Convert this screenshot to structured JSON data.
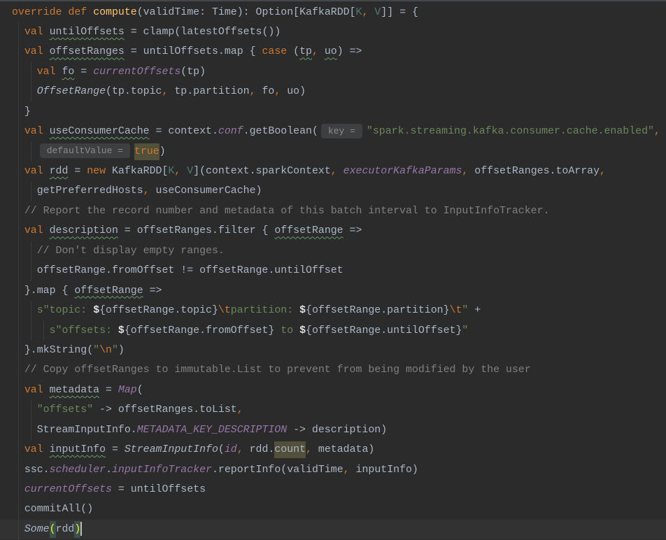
{
  "editor": {
    "lines": [
      {
        "tokens": [
          {
            "keyword": "override"
          },
          {
            "plain": " "
          },
          {
            "keyword": "def"
          },
          {
            "plain": " "
          },
          {
            "method": "compute"
          },
          {
            "plain": "(validTime: Time): Option[KafkaRDD["
          },
          {
            "type_param": "K"
          },
          {
            "comma": ","
          },
          {
            "plain": " "
          },
          {
            "type_param": "V"
          },
          {
            "plain": "]] = {"
          }
        ]
      },
      {
        "tokens": [
          {
            "plain": "  "
          },
          {
            "keyword": "val"
          },
          {
            "plain": " "
          },
          {
            "plain": "untilOffsets",
            "squiggly": true
          },
          {
            "plain": " = clamp(latestOffsets())"
          }
        ]
      },
      {
        "tokens": [
          {
            "plain": "  "
          },
          {
            "keyword": "val"
          },
          {
            "plain": " "
          },
          {
            "plain": "offsetRanges",
            "squiggly": true
          },
          {
            "plain": " = untilOffsets.map { "
          },
          {
            "keyword": "case"
          },
          {
            "plain": " ("
          },
          {
            "plain": "tp",
            "squiggly": true
          },
          {
            "comma": ","
          },
          {
            "plain": " "
          },
          {
            "plain": "uo",
            "squiggly": true
          },
          {
            "plain": ") =>"
          }
        ]
      },
      {
        "tokens": [
          {
            "plain": "    "
          },
          {
            "keyword": "val"
          },
          {
            "plain": " "
          },
          {
            "plain": "fo",
            "squiggly": true
          },
          {
            "plain": " = "
          },
          {
            "field": "currentOffsets"
          },
          {
            "plain": "(tp)"
          }
        ]
      },
      {
        "tokens": [
          {
            "plain": "    "
          },
          {
            "call": "OffsetRange"
          },
          {
            "plain": "(tp.topic"
          },
          {
            "comma": ","
          },
          {
            "plain": " tp.partition"
          },
          {
            "comma": ","
          },
          {
            "plain": " fo"
          },
          {
            "comma": ","
          },
          {
            "plain": " uo)"
          }
        ]
      },
      {
        "tokens": [
          {
            "plain": "  }"
          }
        ]
      },
      {
        "tokens": [
          {
            "plain": "  "
          },
          {
            "keyword": "val"
          },
          {
            "plain": " "
          },
          {
            "plain": "useConsumerCache",
            "squiggly": true
          },
          {
            "plain": " = context."
          },
          {
            "field": "conf"
          },
          {
            "plain": ".getBoolean("
          },
          {
            "hint": "key ="
          },
          {
            "string": "\"spark.streaming.kafka.consumer.cache.enabled\""
          },
          {
            "comma": ","
          }
        ]
      },
      {
        "tokens": [
          {
            "plain": "    "
          },
          {
            "hint": "defaultValue ="
          },
          {
            "keyword": "true",
            "usage": true
          },
          {
            "plain": ")"
          }
        ]
      },
      {
        "tokens": [
          {
            "plain": "  "
          },
          {
            "keyword": "val"
          },
          {
            "plain": " "
          },
          {
            "plain": "rdd",
            "squiggly": true
          },
          {
            "plain": " = "
          },
          {
            "keyword": "new"
          },
          {
            "plain": " KafkaRDD["
          },
          {
            "type_param": "K"
          },
          {
            "comma": ","
          },
          {
            "plain": " "
          },
          {
            "type_param": "V"
          },
          {
            "plain": "](context.sparkContext"
          },
          {
            "comma": ","
          },
          {
            "plain": " "
          },
          {
            "field": "executorKafkaParams"
          },
          {
            "comma": ","
          },
          {
            "plain": " offsetRanges.toArray"
          },
          {
            "comma": ","
          }
        ]
      },
      {
        "tokens": [
          {
            "plain": "    getPreferredHosts"
          },
          {
            "comma": ","
          },
          {
            "plain": " useConsumerCache)"
          }
        ]
      },
      {
        "tokens": [
          {
            "plain": "  "
          },
          {
            "comment": "// Report the record number and metadata of this batch interval to InputInfoTracker."
          }
        ]
      },
      {
        "tokens": [
          {
            "plain": "  "
          },
          {
            "keyword": "val"
          },
          {
            "plain": " "
          },
          {
            "plain": "description",
            "squiggly": true
          },
          {
            "plain": " = offsetRanges.filter { "
          },
          {
            "plain": "offsetRange",
            "squiggly": true
          },
          {
            "plain": " =>"
          }
        ]
      },
      {
        "tokens": [
          {
            "plain": "    "
          },
          {
            "comment": "// Don't display empty ranges."
          }
        ]
      },
      {
        "tokens": [
          {
            "plain": "    offsetRange.fromOffset != offsetRange.untilOffset"
          }
        ]
      },
      {
        "tokens": [
          {
            "plain": "  }.map { "
          },
          {
            "plain": "offsetRange",
            "squiggly": true
          },
          {
            "plain": " =>"
          }
        ]
      },
      {
        "tokens": [
          {
            "plain": "    "
          },
          {
            "string": "s\"topic: "
          },
          {
            "interp": "$"
          },
          {
            "plain": "{offsetRange.topic}"
          },
          {
            "escape": "\\t"
          },
          {
            "string": "partition: "
          },
          {
            "interp": "$"
          },
          {
            "plain": "{offsetRange.partition}"
          },
          {
            "escape": "\\t"
          },
          {
            "string": "\""
          },
          {
            "plain": " +"
          }
        ]
      },
      {
        "tokens": [
          {
            "plain": "      "
          },
          {
            "string": "s\"offsets: "
          },
          {
            "interp": "$"
          },
          {
            "plain": "{offsetRange.fromOffset}"
          },
          {
            "string": " to "
          },
          {
            "interp": "$"
          },
          {
            "plain": "{offsetRange.untilOffset}"
          },
          {
            "string": "\""
          }
        ]
      },
      {
        "tokens": [
          {
            "plain": "  }.mkString("
          },
          {
            "string": "\""
          },
          {
            "escape": "\\n"
          },
          {
            "string": "\""
          },
          {
            "plain": ")"
          }
        ]
      },
      {
        "tokens": [
          {
            "plain": "  "
          },
          {
            "comment": "// Copy offsetRanges to immutable.List to prevent from being modified by the user"
          }
        ]
      },
      {
        "tokens": [
          {
            "plain": "  "
          },
          {
            "keyword": "val"
          },
          {
            "plain": " "
          },
          {
            "plain": "metadata",
            "squiggly": true
          },
          {
            "plain": " = "
          },
          {
            "field": "Map"
          },
          {
            "plain": "("
          }
        ]
      },
      {
        "tokens": [
          {
            "plain": "    "
          },
          {
            "string": "\"offsets\""
          },
          {
            "plain": " -> offsetRanges.toList"
          },
          {
            "comma": ","
          }
        ]
      },
      {
        "tokens": [
          {
            "plain": "    StreamInputInfo."
          },
          {
            "field": "METADATA_KEY_DESCRIPTION"
          },
          {
            "plain": " -> description)"
          }
        ]
      },
      {
        "tokens": [
          {
            "plain": "  "
          },
          {
            "keyword": "val"
          },
          {
            "plain": " "
          },
          {
            "plain": "inputInfo",
            "squiggly": true
          },
          {
            "plain": " = "
          },
          {
            "call": "StreamInputInfo"
          },
          {
            "plain": "("
          },
          {
            "field": "id"
          },
          {
            "comma": ","
          },
          {
            "plain": " rdd."
          },
          {
            "plain": "count",
            "usage": true
          },
          {
            "comma": ","
          },
          {
            "plain": " metadata)"
          }
        ]
      },
      {
        "tokens": [
          {
            "plain": "  ssc."
          },
          {
            "field": "scheduler"
          },
          {
            "plain": "."
          },
          {
            "field": "inputInfoTracker"
          },
          {
            "plain": ".reportInfo(validTime"
          },
          {
            "comma": ","
          },
          {
            "plain": " inputInfo)"
          }
        ]
      },
      {
        "tokens": [
          {
            "plain": "  "
          },
          {
            "field": "currentOffsets"
          },
          {
            "plain": " = untilOffsets"
          }
        ]
      },
      {
        "tokens": [
          {
            "plain": "  commitAll()"
          }
        ]
      },
      {
        "current": true,
        "tokens": [
          {
            "plain": "  "
          },
          {
            "call": "Some"
          },
          {
            "brace": "("
          },
          {
            "plain": "rdd"
          },
          {
            "brace": ")",
            "caret": true
          }
        ]
      }
    ]
  },
  "syntax_colors": {
    "background": "#2B2B2B",
    "current_line": "#323232",
    "plain": "#A9B7C6",
    "keyword": "#CC7832",
    "method": "#FFC66D",
    "type_param": "#507874",
    "comma": "#CC7832",
    "field": "#9876AA",
    "call": "#A9B7C6",
    "string": "#6A8759",
    "escape": "#CC7832",
    "interp": "#E0E0E0",
    "comment": "#808080",
    "hint_text": "#8C8C8C",
    "hint_background": "#3D3F41",
    "usage_highlight": "#52503A",
    "brace_text": "#FFEF28",
    "brace_background": "#3B514D",
    "indent_guide": "#3C3C3C",
    "squiggly": "#659C6B",
    "caret": "#BBBBBB"
  }
}
